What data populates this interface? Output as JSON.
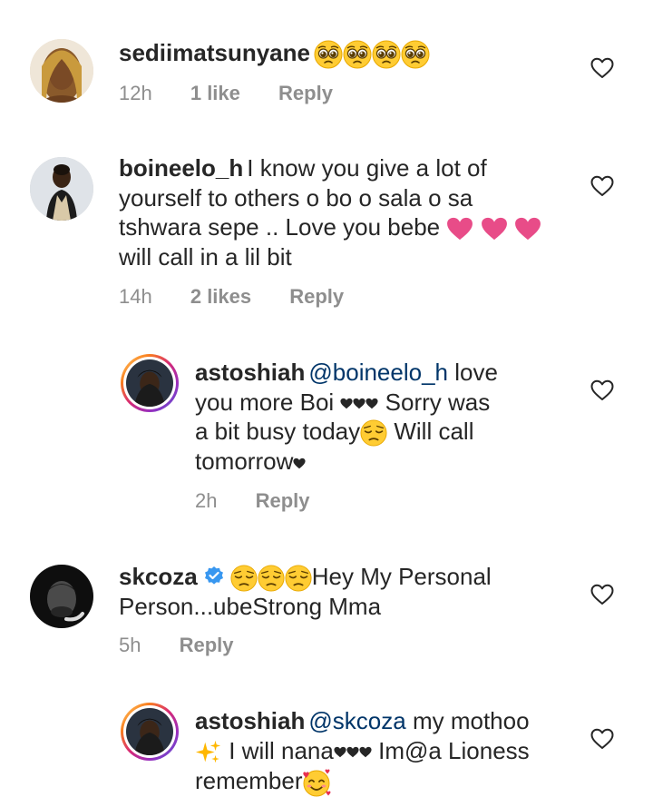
{
  "comments": [
    {
      "username": "sediimatsunyane",
      "text": "",
      "emojis_after_username": "pleading x4",
      "time": "12h",
      "likes": "1 like",
      "reply": "Reply"
    },
    {
      "username": "boineelo_h",
      "text_line1": "I know you give a lot of",
      "text_line2": "yourself to others o bo o sala o sa",
      "text_line3": "tshwara sepe .. Love you bebe",
      "text_line4": "will call in a lil bit",
      "time": "14h",
      "likes": "2 likes",
      "reply": "Reply"
    },
    {
      "username": "astoshiah",
      "mention": "@boineelo_h",
      "text_a": "love",
      "text_b": "you more Boi",
      "text_c": "Sorry was",
      "text_d": "a bit busy today",
      "text_e": "Will call",
      "text_f": "tomorrow",
      "time": "2h",
      "reply": "Reply"
    },
    {
      "username": "skcoza",
      "text_a": "Hey My Personal",
      "text_b": "Person...ubeStrong Mma",
      "time": "5h",
      "reply": "Reply"
    },
    {
      "username": "astoshiah",
      "mention": "@skcoza",
      "text_a": "my mothoo",
      "text_b": "I will nana",
      "text_c": "Im@a Lioness",
      "text_d": "remember"
    }
  ],
  "icons": {
    "heart": "heart-outline-icon",
    "verified": "verified-badge-icon"
  },
  "colors": {
    "text": "#262626",
    "meta": "#8e8e8e",
    "mention": "#003569",
    "verified": "#3897f0",
    "heart_emoji": "#e84c88"
  }
}
